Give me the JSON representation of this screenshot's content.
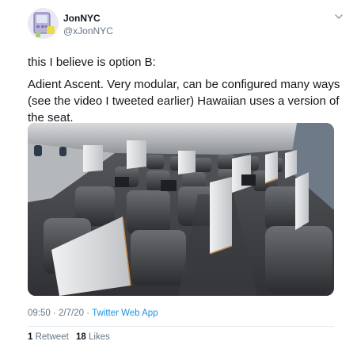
{
  "author": {
    "display_name": "JonNYC",
    "handle": "@xJonNYC",
    "avatar_icon": "robot-avatar-icon"
  },
  "tweet": {
    "paragraph_1": "this I believe is option B:",
    "paragraph_2": "Adient Ascent.  Very modular, can be configured many ways (see the video I tweeted earlier) Hawaiian uses a version of the seat.",
    "image_alt": "Rendering of aircraft business class cabin with staggered seats"
  },
  "meta": {
    "time": "09:50",
    "date": "2/7/20",
    "separator": "·",
    "app": "Twitter Web App"
  },
  "stats": {
    "retweet_count": "1",
    "retweet_label": "Retweet",
    "like_count": "18",
    "like_label": "Likes"
  },
  "colors": {
    "text": "#14171a",
    "secondary": "#657786",
    "link": "#1b95e0"
  }
}
